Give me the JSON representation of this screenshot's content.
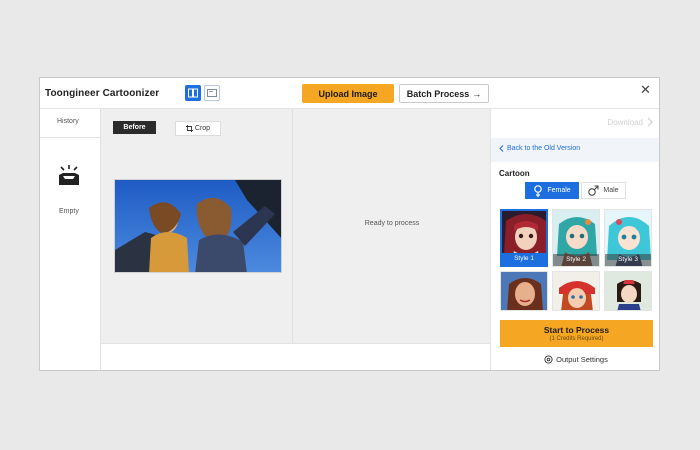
{
  "app": {
    "title": "Toongineer Cartoonizer"
  },
  "toolbar": {
    "upload_label": "Upload Image",
    "batch_label": "Batch Process",
    "batch_arrow": "→",
    "close_glyph": "✕"
  },
  "sidebar": {
    "history_label": "History",
    "empty_label": "Empty"
  },
  "canvas": {
    "before_label": "Before",
    "crop_label": "Crop",
    "ready_label": "Ready to process"
  },
  "panel": {
    "download_label": "Download",
    "old_version_label": "Back to the Old Version",
    "section_title": "Cartoon",
    "gender": {
      "female": "Female",
      "male": "Male",
      "selected": "Female"
    },
    "styles": [
      {
        "label": "Style 1",
        "selected": true
      },
      {
        "label": "Style 2",
        "selected": false
      },
      {
        "label": "Style 3",
        "selected": false
      },
      {
        "label": "",
        "selected": false
      },
      {
        "label": "",
        "selected": false
      },
      {
        "label": "",
        "selected": false
      }
    ],
    "start_label": "Start to Process",
    "start_sub": "(1 Credits Required)",
    "output_settings_label": "Output Settings"
  },
  "colors": {
    "accent": "#1d6fe0",
    "primary_button": "#f5a623"
  }
}
